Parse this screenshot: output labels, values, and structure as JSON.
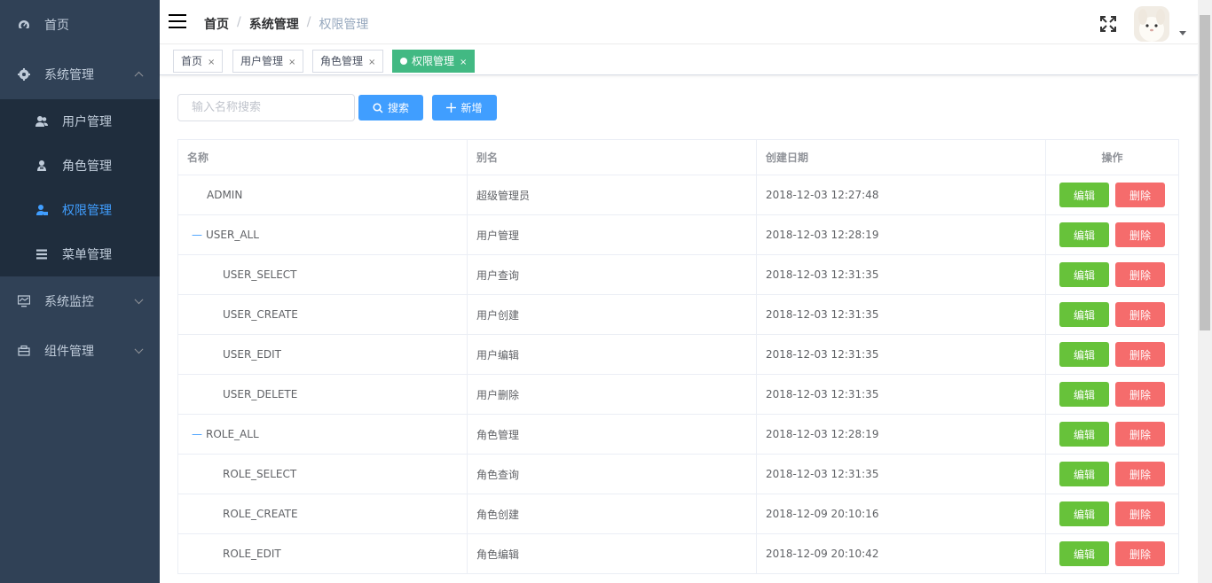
{
  "sidebar": {
    "items": [
      {
        "label": "首页",
        "icon": "dashboard-icon"
      },
      {
        "label": "系统管理",
        "icon": "gear-icon",
        "expanded": true,
        "children": [
          {
            "label": "用户管理",
            "icon": "users-icon"
          },
          {
            "label": "角色管理",
            "icon": "role-icon"
          },
          {
            "label": "权限管理",
            "icon": "permission-icon",
            "active": true
          },
          {
            "label": "菜单管理",
            "icon": "menu-icon"
          }
        ]
      },
      {
        "label": "系统监控",
        "icon": "monitor-icon"
      },
      {
        "label": "组件管理",
        "icon": "component-icon"
      }
    ]
  },
  "navbar": {
    "breadcrumb": [
      "首页",
      "系统管理",
      "权限管理"
    ]
  },
  "tags": [
    {
      "label": "首页"
    },
    {
      "label": "用户管理"
    },
    {
      "label": "角色管理"
    },
    {
      "label": "权限管理",
      "active": true
    }
  ],
  "toolbar": {
    "search_placeholder": "输入名称搜索",
    "search_label": "搜索",
    "add_label": "新增"
  },
  "table": {
    "columns": [
      "名称",
      "别名",
      "创建日期",
      "操作"
    ],
    "edit_label": "编辑",
    "delete_label": "删除",
    "rows": [
      {
        "name": "ADMIN",
        "alias": "超级管理员",
        "date": "2018-12-03 12:27:48",
        "level": 0,
        "toggle": false
      },
      {
        "name": "USER_ALL",
        "alias": "用户管理",
        "date": "2018-12-03 12:28:19",
        "level": 0,
        "toggle": true
      },
      {
        "name": "USER_SELECT",
        "alias": "用户查询",
        "date": "2018-12-03 12:31:35",
        "level": 1,
        "toggle": false
      },
      {
        "name": "USER_CREATE",
        "alias": "用户创建",
        "date": "2018-12-03 12:31:35",
        "level": 1,
        "toggle": false
      },
      {
        "name": "USER_EDIT",
        "alias": "用户编辑",
        "date": "2018-12-03 12:31:35",
        "level": 1,
        "toggle": false
      },
      {
        "name": "USER_DELETE",
        "alias": "用户删除",
        "date": "2018-12-03 12:31:35",
        "level": 1,
        "toggle": false
      },
      {
        "name": "ROLE_ALL",
        "alias": "角色管理",
        "date": "2018-12-03 12:28:19",
        "level": 0,
        "toggle": true
      },
      {
        "name": "ROLE_SELECT",
        "alias": "角色查询",
        "date": "2018-12-03 12:31:35",
        "level": 1,
        "toggle": false
      },
      {
        "name": "ROLE_CREATE",
        "alias": "角色创建",
        "date": "2018-12-09 20:10:16",
        "level": 1,
        "toggle": false
      },
      {
        "name": "ROLE_EDIT",
        "alias": "角色编辑",
        "date": "2018-12-09 20:10:42",
        "level": 1,
        "toggle": false
      }
    ]
  },
  "colors": {
    "sidebar_bg": "#304156",
    "submenu_bg": "#1f2d3d",
    "accent": "#409eff",
    "active_tag": "#42b983",
    "edit": "#67c23a",
    "delete": "#f56c6c"
  }
}
